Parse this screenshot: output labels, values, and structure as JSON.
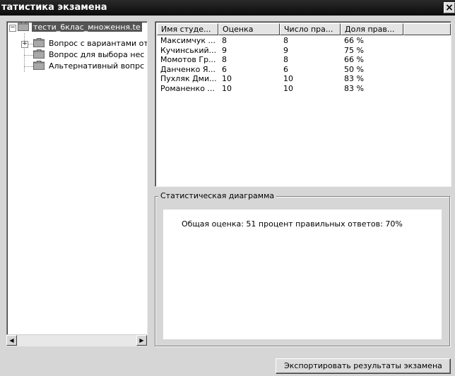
{
  "window": {
    "title": "татистика экзамена",
    "close_glyph": "×"
  },
  "tree": {
    "root_label": "тести_6клас_множення.te",
    "children": [
      {
        "label": "Вопрос с вариантами от",
        "expandable": true
      },
      {
        "label": "Вопрос для выбора нес",
        "expandable": false
      },
      {
        "label": "Альтернативный вопрс",
        "expandable": false
      }
    ],
    "expand_minus": "−",
    "expand_plus": "+"
  },
  "scroll": {
    "left_arrow": "◀",
    "right_arrow": "▶"
  },
  "table": {
    "headers": [
      "Имя студе...",
      "Оценка",
      "Число пра...",
      "Доля прав..."
    ],
    "rows": [
      [
        "Максимчук ...",
        "8",
        "8",
        "66 %"
      ],
      [
        "Кучинський...",
        "9",
        "9",
        "75 %"
      ],
      [
        "Момотов Гр...",
        "8",
        "8",
        "66 %"
      ],
      [
        "Данченко Я...",
        "6",
        "6",
        "50 %"
      ],
      [
        "Пухляк Дми...",
        "10",
        "10",
        "83 %"
      ],
      [
        "Романенко ...",
        "10",
        "10",
        "83 %"
      ]
    ]
  },
  "stats": {
    "group_title": "Статистическая диаграмма",
    "summary": "Общая оценка: 51 процент правильных ответов: 70%"
  },
  "buttons": {
    "export": "Экспортировать результаты экзамена"
  },
  "colors": {
    "titlebar": "#111111",
    "selected": "#555555",
    "folder": "#8a8a8a"
  }
}
